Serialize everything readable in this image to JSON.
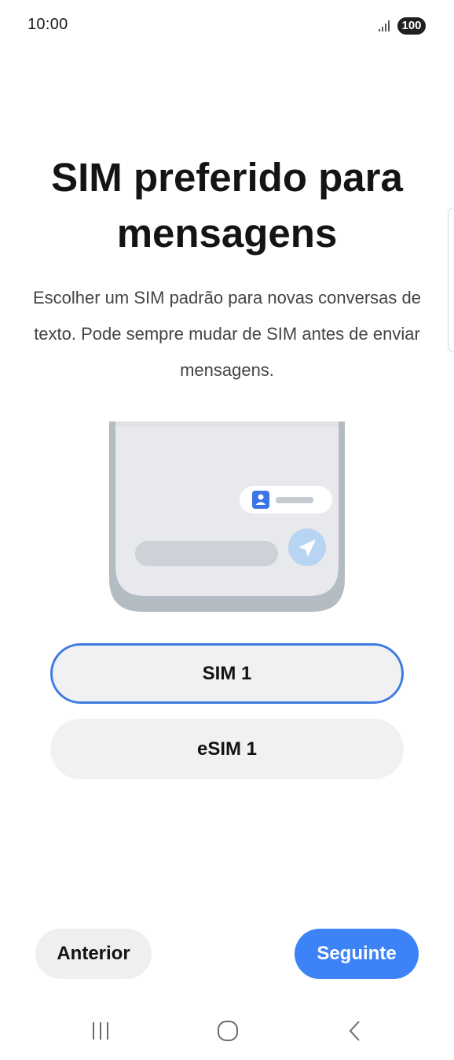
{
  "status_bar": {
    "time": "10:00",
    "battery": "100",
    "signal_icon": "signal-bars-icon"
  },
  "page": {
    "title": "SIM preferido para mensagens",
    "subtitle": "Escolher um SIM padrão para novas conversas de texto. Pode sempre mudar de SIM antes de enviar mensagens."
  },
  "illustration": {
    "icons": [
      "contact-card-icon",
      "send-icon"
    ]
  },
  "sim_options": [
    {
      "label": "SIM 1",
      "selected": true
    },
    {
      "label": "eSIM 1",
      "selected": false
    }
  ],
  "footer": {
    "previous_label": "Anterior",
    "next_label": "Seguinte"
  },
  "nav_bar": {
    "icons": [
      "recent-apps-icon",
      "home-icon",
      "back-icon"
    ]
  },
  "colors": {
    "accent": "#3e82f7",
    "selected_border": "#3e7be0",
    "option_background": "#f1f1f3"
  }
}
